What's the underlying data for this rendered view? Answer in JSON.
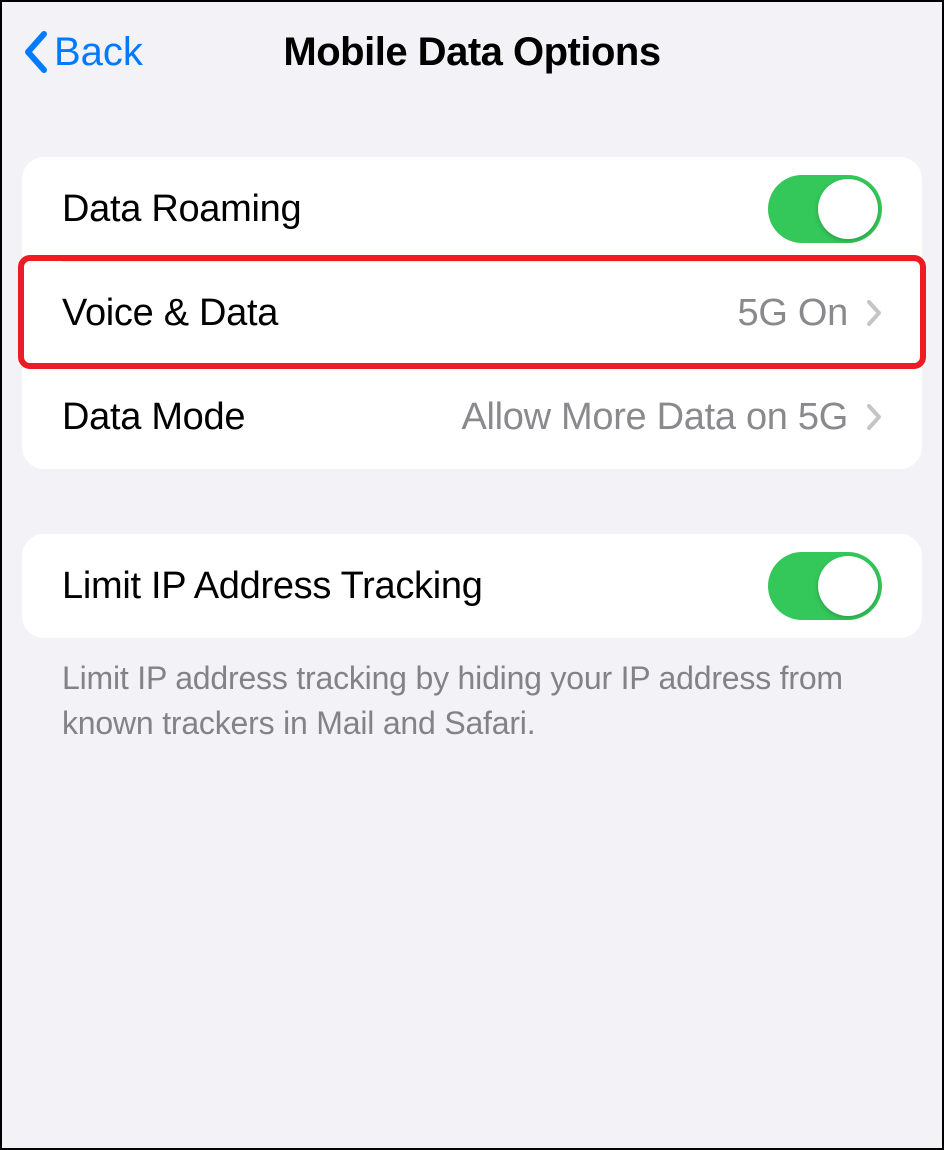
{
  "header": {
    "back_label": "Back",
    "title": "Mobile Data Options"
  },
  "group1": {
    "data_roaming": {
      "label": "Data Roaming",
      "on": true
    },
    "voice_data": {
      "label": "Voice & Data",
      "value": "5G On"
    },
    "data_mode": {
      "label": "Data Mode",
      "value": "Allow More Data on 5G"
    }
  },
  "group2": {
    "limit_ip": {
      "label": "Limit IP Address Tracking",
      "on": true
    },
    "footer": "Limit IP address tracking by hiding your IP address from known trackers in Mail and Safari."
  },
  "colors": {
    "accent": "#007aff",
    "toggle_on": "#34c759",
    "highlight": "#ed1c24",
    "secondary_text": "#8a8a8e"
  }
}
